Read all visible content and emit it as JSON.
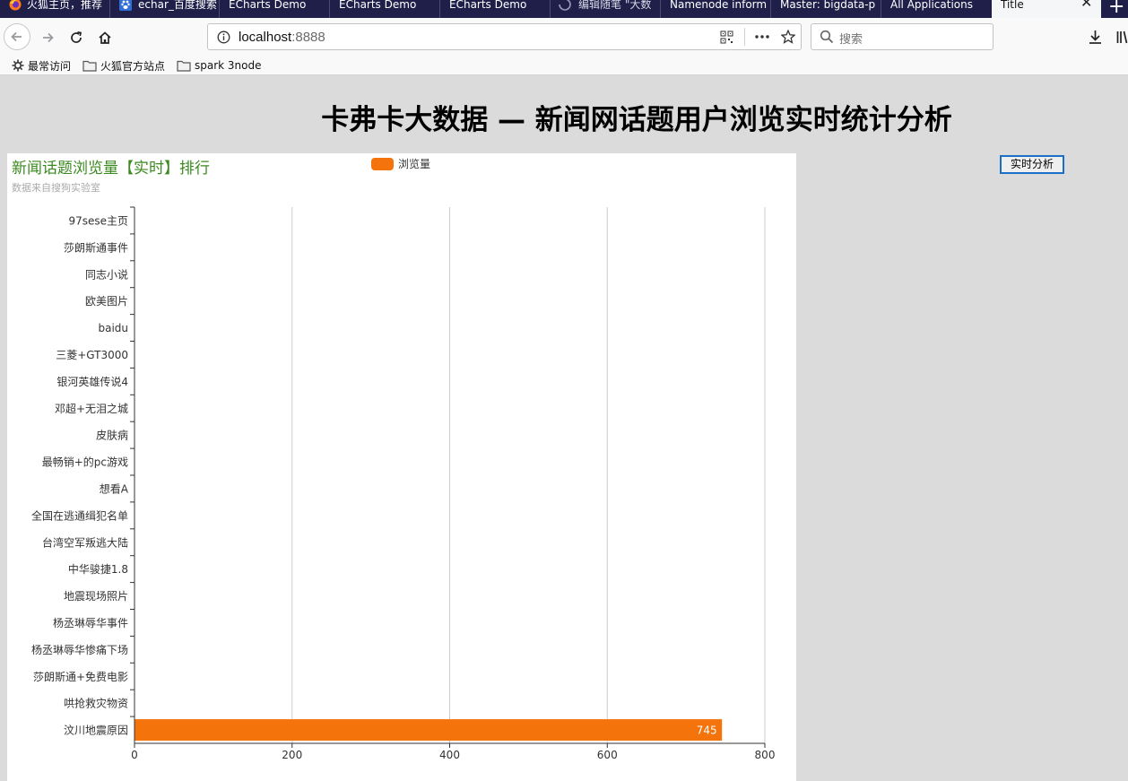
{
  "browser": {
    "tabs": [
      {
        "label": "火狐主页，推荐",
        "icon": "firefox-icon"
      },
      {
        "label": "echar_百度搜索",
        "icon": "baidu-paw-icon"
      },
      {
        "label": "ECharts Demo",
        "icon": ""
      },
      {
        "label": "ECharts Demo",
        "icon": ""
      },
      {
        "label": "ECharts Demo",
        "icon": ""
      },
      {
        "label": "编辑随笔 \"大数",
        "icon": "spinner-icon"
      },
      {
        "label": "Namenode inform",
        "icon": ""
      },
      {
        "label": "Master: bigdata-p",
        "icon": ""
      },
      {
        "label": "All Applications",
        "icon": ""
      },
      {
        "label": "Title",
        "icon": "",
        "active": true
      }
    ],
    "url": {
      "host": "localhost",
      "port": ":8888"
    },
    "search_placeholder": "搜索",
    "bookmarks": [
      {
        "label": "最常访问",
        "icon": "gear-icon"
      },
      {
        "label": "火狐官方站点",
        "icon": "folder-icon"
      },
      {
        "label": "spark 3node",
        "icon": "folder-icon"
      }
    ]
  },
  "page": {
    "title": "卡弗卡大数据 — 新闻网话题用户浏览实时统计分析",
    "realtime_button": "实时分析"
  },
  "colors": {
    "bar": "#f4730a",
    "title": "#3b8a1f",
    "subtitle": "#aaaaaa",
    "grid": "#cccccc"
  },
  "chart_data": {
    "type": "bar",
    "orientation": "horizontal",
    "title": "新闻话题浏览量【实时】排行",
    "subtitle": "数据来自搜狗实验室",
    "legend": [
      "浏览量"
    ],
    "legend_position": "top-center",
    "categories": [
      "97sese主页",
      "莎朗斯通事件",
      "同志小说",
      "欧美图片",
      "baidu",
      "三菱+GT3000",
      "银河英雄传说4",
      "邓超+无泪之城",
      "皮肤病",
      "最畅销+的pc游戏",
      "想看A",
      "全国在逃通缉犯名单",
      "台湾空军叛逃大陆",
      "中华骏捷1.8",
      "地震现场照片",
      "杨丞琳辱华事件",
      "杨丞琳辱华惨痛下场",
      "莎朗斯通+免费电影",
      "哄抢救灾物资",
      "汶川地震原因"
    ],
    "series": [
      {
        "name": "浏览量",
        "values": [
          0,
          0,
          0,
          0,
          0,
          0,
          0,
          0,
          0,
          0,
          0,
          0,
          0,
          0,
          0,
          0,
          0,
          0,
          0,
          745
        ],
        "labels": [
          "",
          "",
          "",
          "",
          "",
          "",
          "",
          "",
          "",
          "",
          "",
          "",
          "",
          "",
          "",
          "",
          "",
          "",
          "",
          "745"
        ]
      }
    ],
    "xlim": [
      0,
      800
    ],
    "xticks": [
      "0",
      "200",
      "400",
      "600",
      "800"
    ],
    "grid": true
  }
}
